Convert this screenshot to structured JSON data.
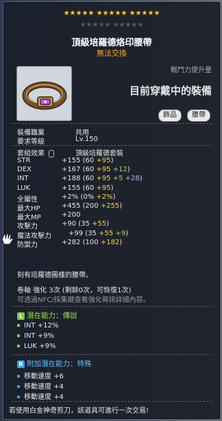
{
  "item": {
    "stars_row1": "★★★★★  ★★★★★  ★★★★★",
    "stars_row2": "★★★★★  ★★★★★",
    "name": "頂級培羅德烙印腰帶",
    "trade_note": "無法交換",
    "combat_power_label": "戰鬥力提升量",
    "equipped_label": "目前穿戴中的裝備",
    "tag_accessory": "飾品",
    "tag_belt": "腰帶"
  },
  "requirements": {
    "job_label": "裝備職業",
    "job_value": "共用",
    "level_label": "要求等級",
    "level_value": "Lv.150"
  },
  "set": {
    "label": "套組效果",
    "value": "頂級培羅德套裝"
  },
  "stats": [
    {
      "label": "STR",
      "total": "+155",
      "base": "(60 ",
      "p1": "+95",
      "p2": "",
      "p3": "",
      "end": ")"
    },
    {
      "label": "DEX",
      "total": "+167",
      "base": "(60 ",
      "p1": "+95",
      "p2": " +12",
      "p3": "",
      "end": ")"
    },
    {
      "label": "INT",
      "total": "+188",
      "base": "(60 ",
      "p1": "+95",
      "p2": " +5",
      "p3": " +28",
      "end": ")"
    },
    {
      "label": "LUK",
      "total": "+155",
      "base": "(60 ",
      "p1": "+95",
      "p2": "",
      "p3": "",
      "end": ")"
    },
    {
      "label": "全屬性",
      "total": "+2%",
      "base": "(0% ",
      "p1": "+2%",
      "p2": "",
      "p3": "",
      "end": ")"
    },
    {
      "label": "最大HP",
      "total": "+455",
      "base": "(200 ",
      "p1": "+255",
      "p2": "",
      "p3": "",
      "end": ")"
    },
    {
      "label": "最大MP",
      "total": "+200",
      "base": "",
      "p1": "",
      "p2": "",
      "p3": "",
      "end": ""
    },
    {
      "label": "攻擊力",
      "total": "+90",
      "base": "(35 ",
      "p1": "+55",
      "p2": "",
      "p3": "",
      "end": ")"
    },
    {
      "label": "魔法攻擊力",
      "total": "+99",
      "base": "(35 ",
      "p1": "+55",
      "p2": " +9",
      "p3": "",
      "end": ")"
    },
    {
      "label": "防禦力",
      "total": "+282",
      "base": "(100 ",
      "p1": "+182",
      "p2": "",
      "p3": "",
      "end": ")"
    }
  ],
  "description": "刻有培羅德圖樣的腰帶。",
  "scroll_line": "卷軸 強化 3次 (剩餘0次，可恢復1次)",
  "nfc_hint": "可透過NFC/採集鍵查看強化資訊詳細內容。",
  "potential": {
    "badge": "L",
    "label": "潛在能力：",
    "grade": "傳說",
    "lines": [
      "INT +12%",
      "INT +9%",
      "LUK +9%"
    ]
  },
  "additional": {
    "badge": "R",
    "label": "附加潛在能力：",
    "grade": "特殊",
    "lines": [
      "移動速度 +6",
      "移動速度 +4",
      "移動速度 +4"
    ]
  },
  "scissors_note": "若使用白金神奇剪刀，該道具可進行一次交易!",
  "colors": {
    "gold": "#ffd42a",
    "green": "#9de04c",
    "blue": "#aab4ff",
    "legend_green": "#7cc94a",
    "special_blue": "#3aa0e8"
  }
}
